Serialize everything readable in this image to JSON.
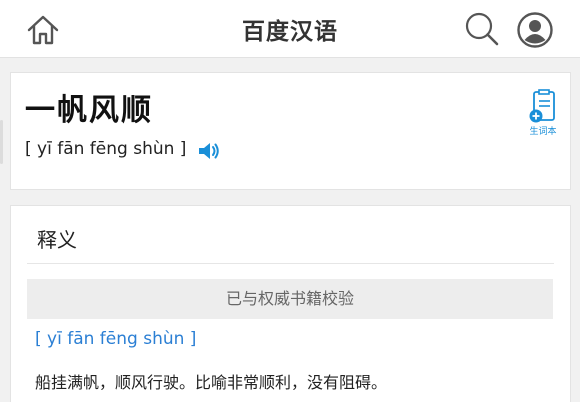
{
  "header": {
    "title": "百度汉语",
    "icons": {
      "home": "home-icon",
      "search": "search-icon",
      "user": "user-icon"
    }
  },
  "word": {
    "text": "一帆风顺",
    "pinyin": "[ yī fān fēng shùn ]",
    "speaker_icon": "speaker-icon",
    "vocab_label": "生词本"
  },
  "definition": {
    "title": "释义",
    "verified": "已与权威书籍校验",
    "pinyin": "[ yī fān fēng shùn ]",
    "text": "船挂满帆，顺风行驶。比喻非常顺利，没有阻碍。"
  },
  "colors": {
    "accent": "#1a8fd8",
    "link": "#2b7fd4",
    "background": "#f1f1f1"
  }
}
